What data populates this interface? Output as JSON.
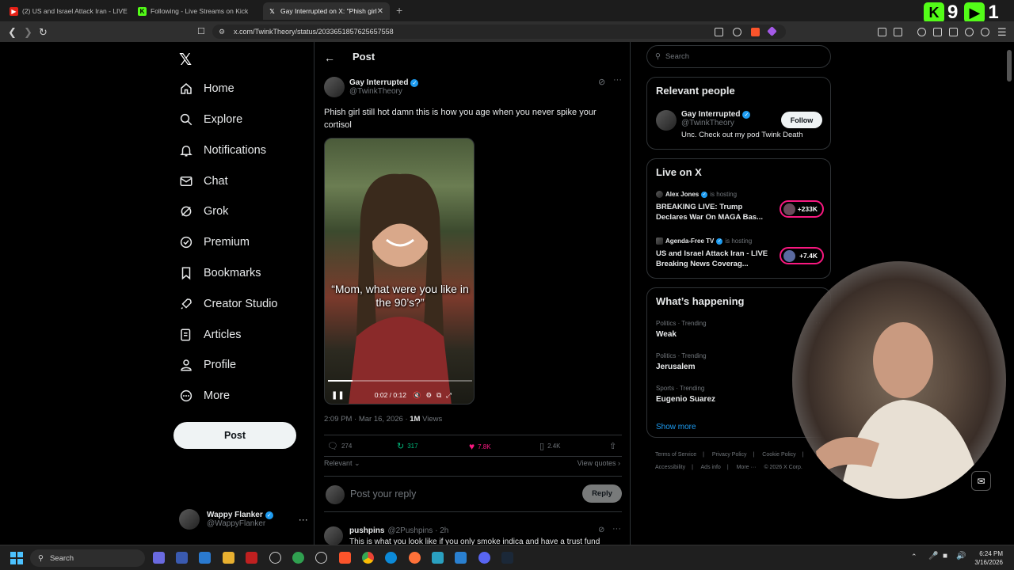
{
  "browser": {
    "tabs": [
      {
        "title": "(2) US and Israel Attack Iran - LIVE"
      },
      {
        "title": "Following - Live Streams on Kick"
      },
      {
        "title": "Gay Interrupted on X: \"Phish girl"
      }
    ],
    "url": "x.com/TwinkTheory/status/2033651857625657558",
    "overlay_counts": [
      "9",
      "1"
    ]
  },
  "sidebar": {
    "items": [
      {
        "label": "Home"
      },
      {
        "label": "Explore"
      },
      {
        "label": "Notifications"
      },
      {
        "label": "Chat"
      },
      {
        "label": "Grok"
      },
      {
        "label": "Premium"
      },
      {
        "label": "Bookmarks"
      },
      {
        "label": "Creator Studio"
      },
      {
        "label": "Articles"
      },
      {
        "label": "Profile"
      },
      {
        "label": "More"
      }
    ],
    "post_label": "Post",
    "account": {
      "name": "Wappy Flanker",
      "handle": "@WappyFlanker"
    }
  },
  "post": {
    "header": "Post",
    "author_name": "Gay Interrupted",
    "author_handle": "@TwinkTheory",
    "text": "Phish girl still hot damn this is how you age when you never spike your cortisol",
    "video_caption": "“Mom, what were you like in the 90’s?”",
    "video_time": "0:02 / 0:12",
    "video_progress": 0.17,
    "timestamp": "2:09 PM · Mar 16, 2026 · ",
    "views_count": "1M",
    "views_label": " Views",
    "replies": "274",
    "reposts": "317",
    "likes": "7.8K",
    "bookmarks": "2.4K",
    "sort_label": "Relevant",
    "view_quotes": "View quotes",
    "reply_placeholder": "Post your reply",
    "reply_button": "Reply",
    "next_reply": {
      "name": "pushpins",
      "handle": "@2Pushpins · 2h",
      "text": "This is what you look like if you only smoke indica and have a trust fund"
    }
  },
  "right": {
    "search_placeholder": "Search",
    "relevant_people_title": "Relevant people",
    "person": {
      "name": "Gay Interrupted",
      "handle": "@TwinkTheory",
      "bio": "Unc. Check out my pod Twink Death",
      "follow": "Follow"
    },
    "live_title": "Live on X",
    "live": [
      {
        "host": "Alex Jones",
        "status": "is hosting",
        "title": "BREAKING LIVE: Trump Declares War On MAGA Bas...",
        "count": "+233K"
      },
      {
        "host": "Agenda-Free TV",
        "status": "is hosting",
        "title": "US and Israel Attack Iran - LIVE Breaking News Coverag...",
        "count": "+7.4K"
      }
    ],
    "happening_title": "What’s happening",
    "trends": [
      {
        "category": "Politics · Trending",
        "name": "Weak"
      },
      {
        "category": "Politics · Trending",
        "name": "Jerusalem"
      },
      {
        "category": "Sports · Trending",
        "name": "Eugenio Suarez"
      }
    ],
    "show_more": "Show more",
    "footer": [
      "Terms of Service",
      "|",
      "Privacy Policy",
      "|",
      "Cookie Policy",
      "|",
      "Accessibility",
      "|",
      "Ads info",
      "|",
      "More ···",
      "© 2026 X Corp."
    ]
  },
  "taskbar": {
    "search": "Search",
    "time": "6:24 PM",
    "date": "3/16/2026"
  },
  "colors": {
    "accent": "#1d9bf0",
    "like": "#f91880",
    "repost": "#00ba7c",
    "live_pill": "#f91880"
  }
}
